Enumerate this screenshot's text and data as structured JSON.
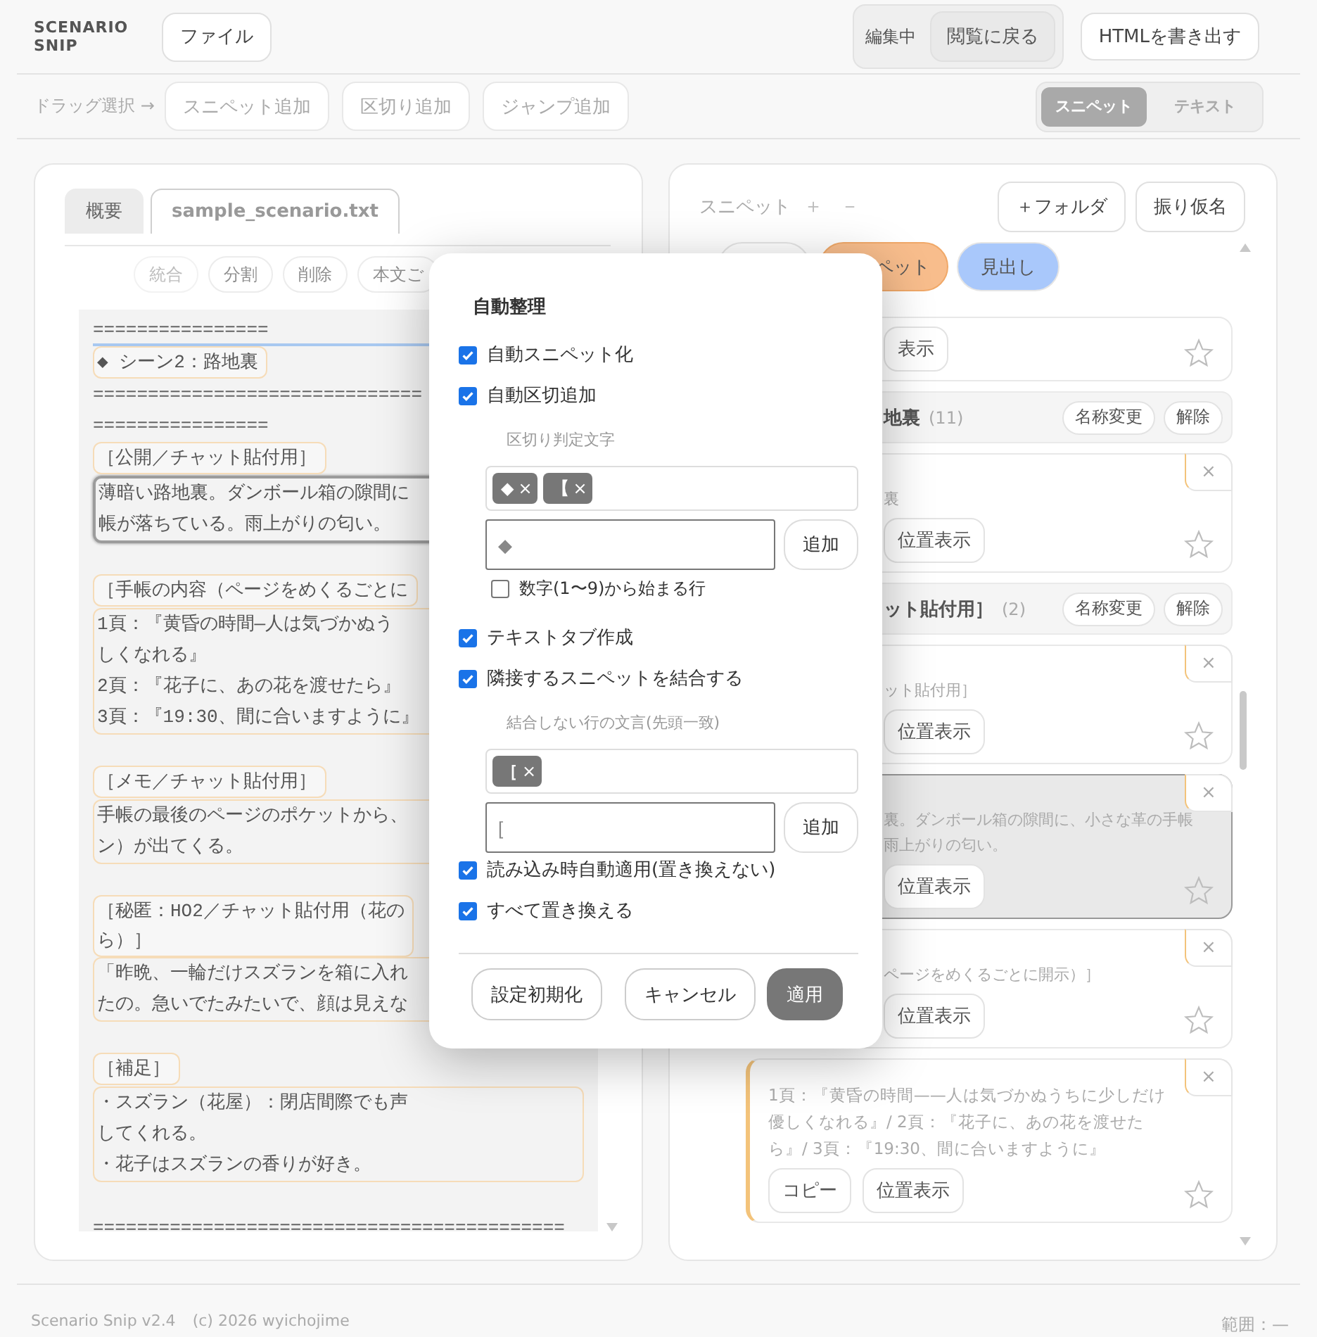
{
  "logo": [
    "SCENARIO",
    "SNIP"
  ],
  "topbar": {
    "file_button": "ファイル",
    "mode_label": "編集中",
    "mode_button": "閲覧に戻る",
    "export_button": "HTMLを書き出す"
  },
  "toolbar": {
    "hint": "ドラッグ選択 →",
    "buttons": [
      {
        "label": "スニペット追加",
        "disabled": true
      },
      {
        "label": "区切り追加",
        "disabled": true
      },
      {
        "label": "ジャンプ追加",
        "disabled": true
      }
    ],
    "view_tabs": [
      {
        "label": "スニペット",
        "selected": true
      },
      {
        "label": "テキスト",
        "selected": false
      }
    ]
  },
  "editor": {
    "tabs": [
      {
        "label": "概要",
        "selected": false
      },
      {
        "label": "sample_scenario.txt",
        "selected": true
      }
    ],
    "actions": [
      {
        "label": "統合",
        "disabled": true
      },
      {
        "label": "分割",
        "disabled": false
      },
      {
        "label": "削除",
        "disabled": false
      },
      {
        "label": "本文ご",
        "disabled": false
      }
    ],
    "blocks": [
      {
        "kind": "rule",
        "text": "================",
        "underlined": true
      },
      {
        "kind": "heading",
        "lines": [
          "◆ シーン2：路地裏"
        ]
      },
      {
        "kind": "rule",
        "text": "==============================",
        "underlined": false
      },
      {
        "kind": "rule",
        "text": "================",
        "underlined": false
      },
      {
        "kind": "heading",
        "lines": [
          "［公開／チャット貼付用］"
        ]
      },
      {
        "kind": "para",
        "lines": [
          "薄暗い路地裏。ダンボール箱の隙間に",
          "帳が落ちている。雨上がりの匂い。"
        ],
        "selected": true
      },
      {
        "kind": "blank"
      },
      {
        "kind": "heading",
        "lines": [
          "［手帳の内容（ページをめくるごとに"
        ]
      },
      {
        "kind": "para",
        "lines": [
          "1頁：『黄昏の時間—人は気づかぬう",
          "しくなれる』",
          "2頁：『花子に、あの花を渡せたら』",
          "3頁：『19:30、間に合いますように』"
        ],
        "selected": false
      },
      {
        "kind": "blank"
      },
      {
        "kind": "heading",
        "lines": [
          "［メモ／チャット貼付用］"
        ]
      },
      {
        "kind": "para",
        "lines": [
          "手帳の最後のページのポケットから、",
          "ン）が出てくる。"
        ],
        "selected": false
      },
      {
        "kind": "blank"
      },
      {
        "kind": "heading",
        "lines": [
          "［秘匿：HO2／チャット貼付用（花の",
          "ら）］"
        ]
      },
      {
        "kind": "para",
        "lines": [
          "「昨晩、一輪だけスズランを箱に入れ",
          "たの。急いでたみたいで、顔は見えな"
        ],
        "selected": false
      },
      {
        "kind": "blank"
      },
      {
        "kind": "heading",
        "lines": [
          "［補足］"
        ]
      },
      {
        "kind": "para",
        "lines": [
          "・スズラン（花屋）：閉店間際でも声",
          "してくれる。",
          "・花子はスズランの香りが好き。"
        ],
        "selected": false
      },
      {
        "kind": "blank"
      },
      {
        "kind": "rule",
        "text": "===========================================",
        "underlined": false
      }
    ]
  },
  "snippets": {
    "title": "スニペット",
    "add": "＋",
    "remove": "－",
    "buttons": [
      "＋フォルダ",
      "振り仮名"
    ],
    "filters": [
      {
        "color": "#ffffff"
      },
      {
        "label": "ペット",
        "color": "#f8bd8c"
      },
      {
        "label": "見出し",
        "color": "#a9c8fb"
      }
    ],
    "items": [
      {
        "kind": "card",
        "buttons": [
          "表示"
        ],
        "starred": false,
        "selected": false,
        "marked": false
      },
      {
        "kind": "folder",
        "name": "地裏",
        "count": "(11)",
        "actions": [
          "名称変更",
          "解除"
        ]
      },
      {
        "kind": "card",
        "close": "×",
        "lines": [
          "裏"
        ],
        "buttons": [
          "位置表示"
        ],
        "starred": false,
        "selected": false,
        "marked": false
      },
      {
        "kind": "folder",
        "name": "ット貼付用］",
        "count": "(2)",
        "actions": [
          "名称変更",
          "解除"
        ]
      },
      {
        "kind": "card",
        "close": "×",
        "lines": [
          "ット貼付用］"
        ],
        "buttons": [
          "位置表示"
        ],
        "starred": false,
        "selected": false,
        "marked": false
      },
      {
        "kind": "card",
        "close": "×",
        "lines": [
          "裏。ダンボール箱の隙間に、小さな革の手帳",
          "雨上がりの匂い。"
        ],
        "buttons": [
          "位置表示"
        ],
        "starred": false,
        "selected": true,
        "marked": false
      },
      {
        "kind": "card",
        "close": "×",
        "lines": [
          "ページをめくるごとに開示）］"
        ],
        "buttons": [
          "位置表示"
        ],
        "starred": false,
        "selected": false,
        "marked": false
      },
      {
        "kind": "card",
        "close": "×",
        "text": "1頁：『黄昏の時間——人は気づかぬうちに少しだけ優しくなれる』/ 2頁：『花子に、あの花を渡せたら』/ 3頁：『19:30、間に合いますように』",
        "buttons": [
          "コピー",
          "位置表示"
        ],
        "starred": false,
        "selected": false,
        "marked": true
      }
    ]
  },
  "dialog": {
    "title": "自動整理",
    "options": [
      {
        "kind": "check",
        "label": "自動スニペット化",
        "checked": true
      },
      {
        "kind": "check",
        "label": "自動区切追加",
        "checked": true
      },
      {
        "kind": "tag_editor",
        "label": "区切り判定文字",
        "tags": [
          {
            "text": "◆",
            "remove": "×"
          },
          {
            "text": "【",
            "remove": "×"
          }
        ],
        "placeholder": "◆",
        "add": "追加"
      },
      {
        "kind": "small_check",
        "label": "数字(1〜9)から始まる行",
        "checked": false
      },
      {
        "kind": "check",
        "label": "テキストタブ作成",
        "checked": true
      },
      {
        "kind": "check",
        "label": "隣接するスニペットを結合する",
        "checked": true
      },
      {
        "kind": "tag_editor",
        "label": "結合しない行の文言(先頭一致)",
        "tags": [
          {
            "text": "［",
            "remove": "×"
          }
        ],
        "placeholder": "[",
        "add": "追加"
      },
      {
        "kind": "check",
        "label": "読み込み時自動適用(置き換えない)",
        "checked": true
      },
      {
        "kind": "check",
        "label": "すべて置き換える",
        "checked": true
      }
    ],
    "buttons": [
      {
        "label": "設定初期化",
        "primary": false
      },
      {
        "label": "キャンセル",
        "primary": false
      },
      {
        "label": "適用",
        "primary": true
      }
    ]
  },
  "footer": {
    "app": "Scenario Snip v2.4",
    "copyright": "(c) 2026 wyichojime",
    "range": "範囲：—"
  }
}
